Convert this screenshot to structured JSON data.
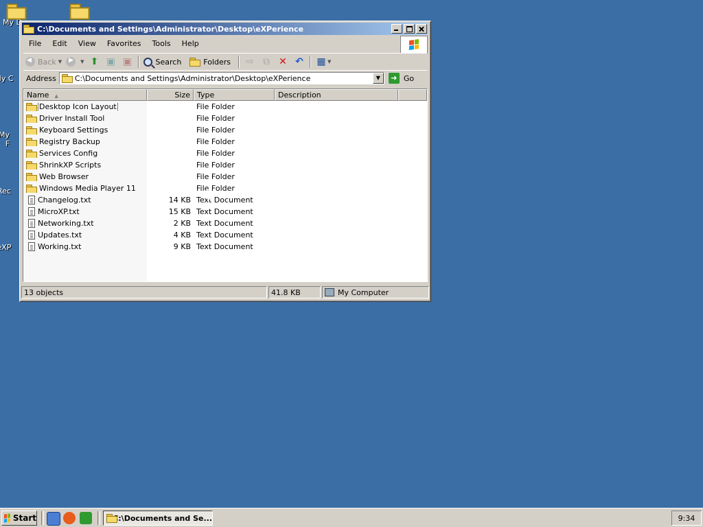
{
  "desktop": {
    "icons": [
      {
        "label": "My D"
      },
      {
        "label": "My C"
      },
      {
        "label": "My"
      },
      {
        "label": "F"
      },
      {
        "label": "Rec"
      },
      {
        "label": "eXP"
      }
    ]
  },
  "window": {
    "title": "C:\\Documents and Settings\\Administrator\\Desktop\\eXPerience",
    "menu": [
      "File",
      "Edit",
      "View",
      "Favorites",
      "Tools",
      "Help"
    ],
    "toolbar": {
      "back": "Back",
      "search": "Search",
      "folders": "Folders"
    },
    "address": {
      "label": "Address",
      "value": "C:\\Documents and Settings\\Administrator\\Desktop\\eXPerience",
      "go": "Go"
    },
    "columns": {
      "name": "Name",
      "size": "Size",
      "type": "Type",
      "description": "Description"
    },
    "files": [
      {
        "name": "Desktop Icon Layout",
        "size": "",
        "type": "File Folder",
        "kind": "folder"
      },
      {
        "name": "Driver Install Tool",
        "size": "",
        "type": "File Folder",
        "kind": "folder"
      },
      {
        "name": "Keyboard Settings",
        "size": "",
        "type": "File Folder",
        "kind": "folder"
      },
      {
        "name": "Registry Backup",
        "size": "",
        "type": "File Folder",
        "kind": "folder"
      },
      {
        "name": "Services Config",
        "size": "",
        "type": "File Folder",
        "kind": "folder"
      },
      {
        "name": "ShrinkXP Scripts",
        "size": "",
        "type": "File Folder",
        "kind": "folder"
      },
      {
        "name": "Web Browser",
        "size": "",
        "type": "File Folder",
        "kind": "folder"
      },
      {
        "name": "Windows Media Player 11",
        "size": "",
        "type": "File Folder",
        "kind": "folder"
      },
      {
        "name": "Changelog.txt",
        "size": "14 KB",
        "type": "Text Document",
        "kind": "doc"
      },
      {
        "name": "MicroXP.txt",
        "size": "15 KB",
        "type": "Text Document",
        "kind": "doc"
      },
      {
        "name": "Networking.txt",
        "size": "2 KB",
        "type": "Text Document",
        "kind": "doc"
      },
      {
        "name": "Updates.txt",
        "size": "4 KB",
        "type": "Text Document",
        "kind": "doc"
      },
      {
        "name": "Working.txt",
        "size": "9 KB",
        "type": "Text Document",
        "kind": "doc"
      }
    ],
    "status": {
      "objects": "13 objects",
      "size": "41.8 KB",
      "zone": "My Computer"
    }
  },
  "taskbar": {
    "start": "Start",
    "task": "C:\\Documents and Se...",
    "clock": "9:34"
  },
  "colors": {
    "desktop": "#3a6ea5",
    "titlebar_start": "#0a246a",
    "titlebar_end": "#a6caf0",
    "face": "#d4d0c8"
  }
}
